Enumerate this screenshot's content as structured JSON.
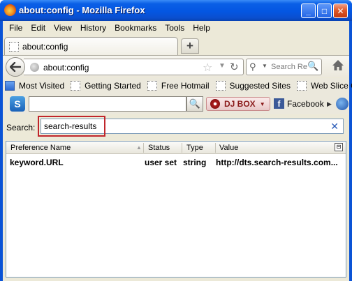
{
  "window": {
    "title": "about:config - Mozilla Firefox",
    "minimize": "_",
    "maximize": "□",
    "close": "✕"
  },
  "menubar": {
    "items": [
      {
        "label": "File"
      },
      {
        "label": "Edit"
      },
      {
        "label": "View"
      },
      {
        "label": "History"
      },
      {
        "label": "Bookmarks"
      },
      {
        "label": "Tools"
      },
      {
        "label": "Help"
      }
    ]
  },
  "tabs": {
    "active_label": "about:config",
    "new_tab": "+"
  },
  "navbar": {
    "url": "about:config",
    "search_placeholder": "Search Re",
    "icons": {
      "back": "back-arrow-icon",
      "star": "☆",
      "dropdown": "▼",
      "reload": "↻",
      "home": "home-icon",
      "search_go": "🔍",
      "engine": "⚲",
      "engine_arrow": "▼"
    }
  },
  "bookmarks": {
    "items": [
      {
        "label": "Most Visited"
      },
      {
        "label": "Getting Started"
      },
      {
        "label": "Free Hotmail"
      },
      {
        "label": "Suggested Sites"
      },
      {
        "label": "Web Slice Gallery"
      }
    ]
  },
  "addon_toolbar": {
    "logo_letter": "S",
    "search_button": "🔍",
    "djbox_label": "DJ BOX",
    "djbox_arrow": "▼",
    "facebook_label": "Facebook",
    "facebook_letter": "f",
    "more_arrow": "▶"
  },
  "filter": {
    "label": "Search:",
    "value": "search-results",
    "clear": "✕"
  },
  "table": {
    "columns": {
      "name": "Preference Name",
      "status": "Status",
      "type": "Type",
      "value": "Value"
    },
    "column_picker": "⊟",
    "rows": [
      {
        "name": "keyword.URL",
        "status": "user set",
        "type": "string",
        "value": "http://dts.search-results.com..."
      }
    ]
  },
  "colors": {
    "highlight_box": "#c0262b",
    "titlebar": "#0456e2",
    "client_bg": "#ece9d8"
  }
}
